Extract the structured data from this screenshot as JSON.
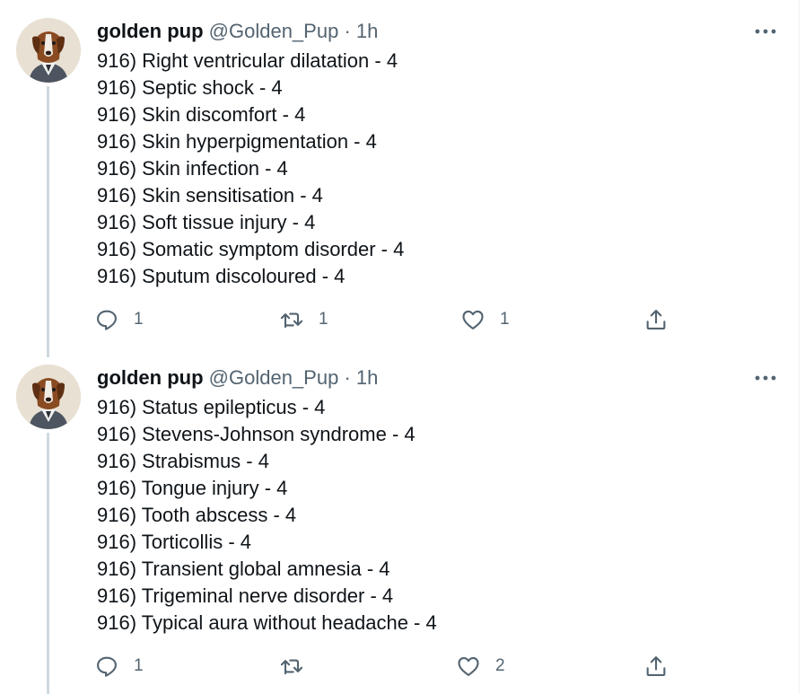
{
  "tweets": [
    {
      "author": {
        "name": "golden pup",
        "handle": "@Golden_Pup"
      },
      "separator": "·",
      "time": "1h",
      "lines": [
        "916) Right ventricular dilatation - 4",
        "916) Septic shock - 4",
        "916) Skin discomfort - 4",
        "916) Skin hyperpigmentation - 4",
        "916) Skin infection - 4",
        "916) Skin sensitisation - 4",
        "916) Soft tissue injury - 4",
        "916) Somatic symptom disorder - 4",
        "916) Sputum discoloured - 4"
      ],
      "actions": {
        "replies": "1",
        "retweets": "1",
        "likes": "1"
      }
    },
    {
      "author": {
        "name": "golden pup",
        "handle": "@Golden_Pup"
      },
      "separator": "·",
      "time": "1h",
      "lines": [
        "916) Status epilepticus - 4",
        "916) Stevens-Johnson syndrome - 4",
        "916) Strabismus - 4",
        "916) Tongue injury - 4",
        "916) Tooth abscess - 4",
        "916) Torticollis - 4",
        "916) Transient global amnesia - 4",
        "916) Trigeminal nerve disorder - 4",
        "916) Typical aura without headache - 4"
      ],
      "actions": {
        "replies": "1",
        "retweets": "",
        "likes": "2"
      }
    }
  ],
  "icons": [
    "reply-icon",
    "retweet-icon",
    "like-icon",
    "share-icon",
    "more-icon"
  ],
  "colors": {
    "text": "#0f1419",
    "secondary": "#536471",
    "thread_line": "#cfd9de"
  }
}
